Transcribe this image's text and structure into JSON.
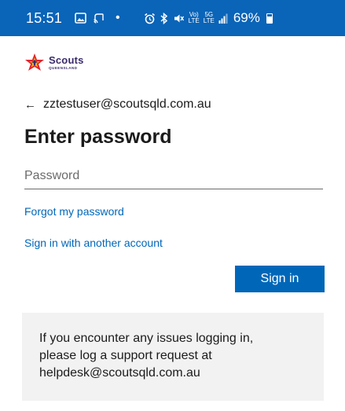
{
  "status_bar": {
    "time": "15:51",
    "lte_top": "Vo)",
    "lte_bottom": "LTE",
    "lte2_top": "5G",
    "lte2_bottom": "LTE",
    "battery": "69%",
    "icons": [
      "gallery-icon",
      "cast-icon",
      "alarm-icon",
      "bluetooth-icon",
      "mute-icon",
      "volte-icon",
      "lte-icon",
      "signal-icon",
      "battery-icon"
    ]
  },
  "logo": {
    "name": "Scouts",
    "sub": "QUEENSLAND",
    "colors": {
      "red": "#e4242b",
      "yellow": "#f5b51b",
      "purple": "#3a2a6b"
    }
  },
  "identity": {
    "back_symbol": "←",
    "email": "zztestuser@scoutsqld.com.au"
  },
  "page": {
    "title": "Enter password"
  },
  "password": {
    "placeholder": "Password",
    "value": ""
  },
  "links": {
    "forgot": "Forgot my password",
    "another_account": "Sign in with another account"
  },
  "buttons": {
    "sign_in": "Sign in"
  },
  "info": {
    "line1": "If you encounter any issues logging in,",
    "line2": "please log a support request at",
    "line3": "helpdesk@scoutsqld.com.au"
  },
  "colors": {
    "status_bar": "#0a64b8",
    "accent": "#0067b8",
    "info_bg": "#f2f2f2"
  }
}
